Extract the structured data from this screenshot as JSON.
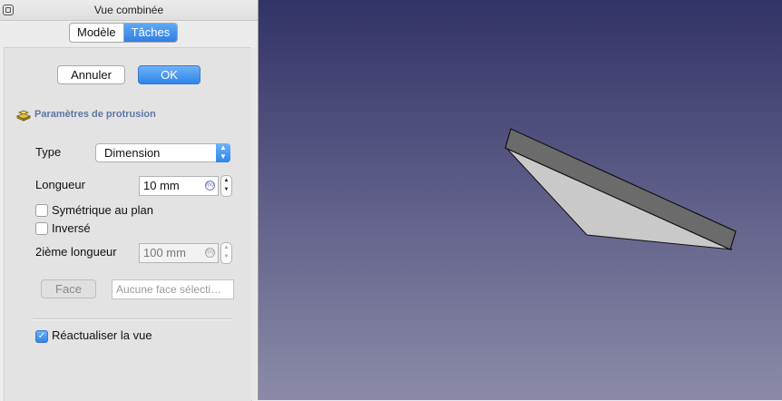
{
  "window": {
    "title": "Vue combinée"
  },
  "tabs": [
    {
      "label": "Modèle",
      "selected": false
    },
    {
      "label": "Tâches",
      "selected": true
    }
  ],
  "dialog": {
    "cancel_label": "Annuler",
    "ok_label": "OK",
    "section_title": "Paramètres de protrusion",
    "section_icon": "pad-icon",
    "type": {
      "label": "Type",
      "value": "Dimension"
    },
    "length": {
      "label": "Longueur",
      "value": "10 mm"
    },
    "symmetric": {
      "label": "Symétrique au plan",
      "checked": false
    },
    "reversed": {
      "label": "Inversé",
      "checked": false
    },
    "second_length": {
      "label": "2ième longueur",
      "value": "100 mm",
      "enabled": false
    },
    "face": {
      "button_label": "Face",
      "placeholder": "Aucune face sélecti…",
      "enabled": false
    },
    "refresh_view": {
      "label": "Réactualiser la vue",
      "checked": true
    }
  },
  "viewport": {
    "background_top": "#323366",
    "background_bottom": "#8b8ba8",
    "face_color": "#c9c9c9",
    "side_color": "#6b6b6b"
  },
  "colors": {
    "accent": "#2f84ea",
    "section_title": "#5e77a3"
  }
}
